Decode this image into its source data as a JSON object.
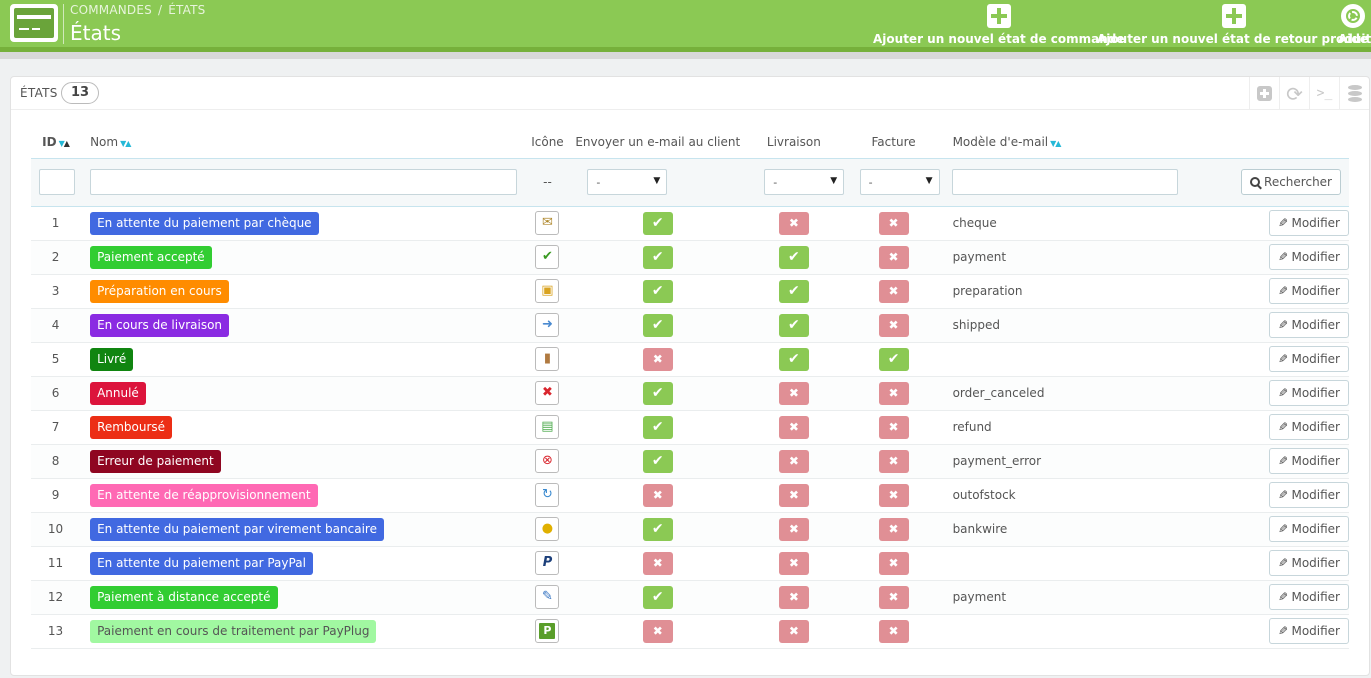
{
  "header": {
    "breadcrumb": [
      "COMMANDES",
      "ÉTATS"
    ],
    "breadcrumb_sep": "/",
    "title": "États",
    "buttons": {
      "add_order_state": "Ajouter un nouvel état de commande",
      "add_return_state": "Ajouter un nouvel état de retour produit",
      "help": "Aide"
    }
  },
  "panel": {
    "title": "ÉTATS",
    "count": "13"
  },
  "table": {
    "columns": {
      "id": "ID",
      "name": "Nom",
      "icon": "Icône",
      "send_email": "Envoyer un e-mail au client",
      "delivery": "Livraison",
      "invoice": "Facture",
      "template": "Modèle d'e-mail"
    },
    "filters": {
      "icon_placeholder": "--",
      "select_value": "-",
      "search_label": "Rechercher"
    },
    "edit_label": "Modifier",
    "rows": [
      {
        "id": "1",
        "name": "En attente du paiement par chèque",
        "color": "#4169E1",
        "icon": "cheque-icon",
        "glyph": "✉",
        "send_email": true,
        "delivery": false,
        "invoice": false,
        "template": "cheque"
      },
      {
        "id": "2",
        "name": "Paiement accepté",
        "color": "#32CD32",
        "icon": "check-icon",
        "glyph": "✔",
        "send_email": true,
        "delivery": true,
        "invoice": false,
        "template": "payment"
      },
      {
        "id": "3",
        "name": "Préparation en cours",
        "color": "#FF8C00",
        "icon": "package-icon",
        "glyph": "▣",
        "send_email": true,
        "delivery": true,
        "invoice": false,
        "template": "preparation"
      },
      {
        "id": "4",
        "name": "En cours de livraison",
        "color": "#8A2BE2",
        "icon": "truck-icon",
        "glyph": "➜",
        "send_email": true,
        "delivery": true,
        "invoice": false,
        "template": "shipped"
      },
      {
        "id": "5",
        "name": "Livré",
        "color": "#108510",
        "icon": "door-icon",
        "glyph": "▮",
        "send_email": false,
        "delivery": true,
        "invoice": true,
        "template": ""
      },
      {
        "id": "6",
        "name": "Annulé",
        "color": "#DC143C",
        "icon": "cross-icon",
        "glyph": "✖",
        "send_email": true,
        "delivery": false,
        "invoice": false,
        "template": "order_canceled"
      },
      {
        "id": "7",
        "name": "Remboursé",
        "color": "#ec2e15",
        "icon": "money-icon",
        "glyph": "▤",
        "send_email": true,
        "delivery": false,
        "invoice": false,
        "template": "refund"
      },
      {
        "id": "8",
        "name": "Erreur de paiement",
        "color": "#8f0621",
        "icon": "error-icon",
        "glyph": "⊗",
        "send_email": true,
        "delivery": false,
        "invoice": false,
        "template": "payment_error"
      },
      {
        "id": "9",
        "name": "En attente de réapprovisionnement",
        "color": "#FF69B4",
        "icon": "restock-icon",
        "glyph": "↻",
        "send_email": false,
        "delivery": false,
        "invoice": false,
        "template": "outofstock"
      },
      {
        "id": "10",
        "name": "En attente du paiement par virement bancaire",
        "color": "#4169E1",
        "icon": "coins-icon",
        "glyph": "●",
        "send_email": true,
        "delivery": false,
        "invoice": false,
        "template": "bankwire"
      },
      {
        "id": "11",
        "name": "En attente du paiement par PayPal",
        "color": "#4169E1",
        "icon": "paypal-icon",
        "glyph": "P",
        "send_email": false,
        "delivery": false,
        "invoice": false,
        "template": ""
      },
      {
        "id": "12",
        "name": "Paiement à distance accepté",
        "color": "#32CD32",
        "icon": "remote-icon",
        "glyph": "✎",
        "send_email": true,
        "delivery": false,
        "invoice": false,
        "template": "payment"
      },
      {
        "id": "13",
        "name": "Paiement en cours de traitement par PayPlug",
        "color": "#a1f8a1",
        "light": true,
        "icon": "payplug-icon",
        "glyph": "P",
        "send_email": false,
        "delivery": false,
        "invoice": false,
        "template": ""
      }
    ]
  }
}
